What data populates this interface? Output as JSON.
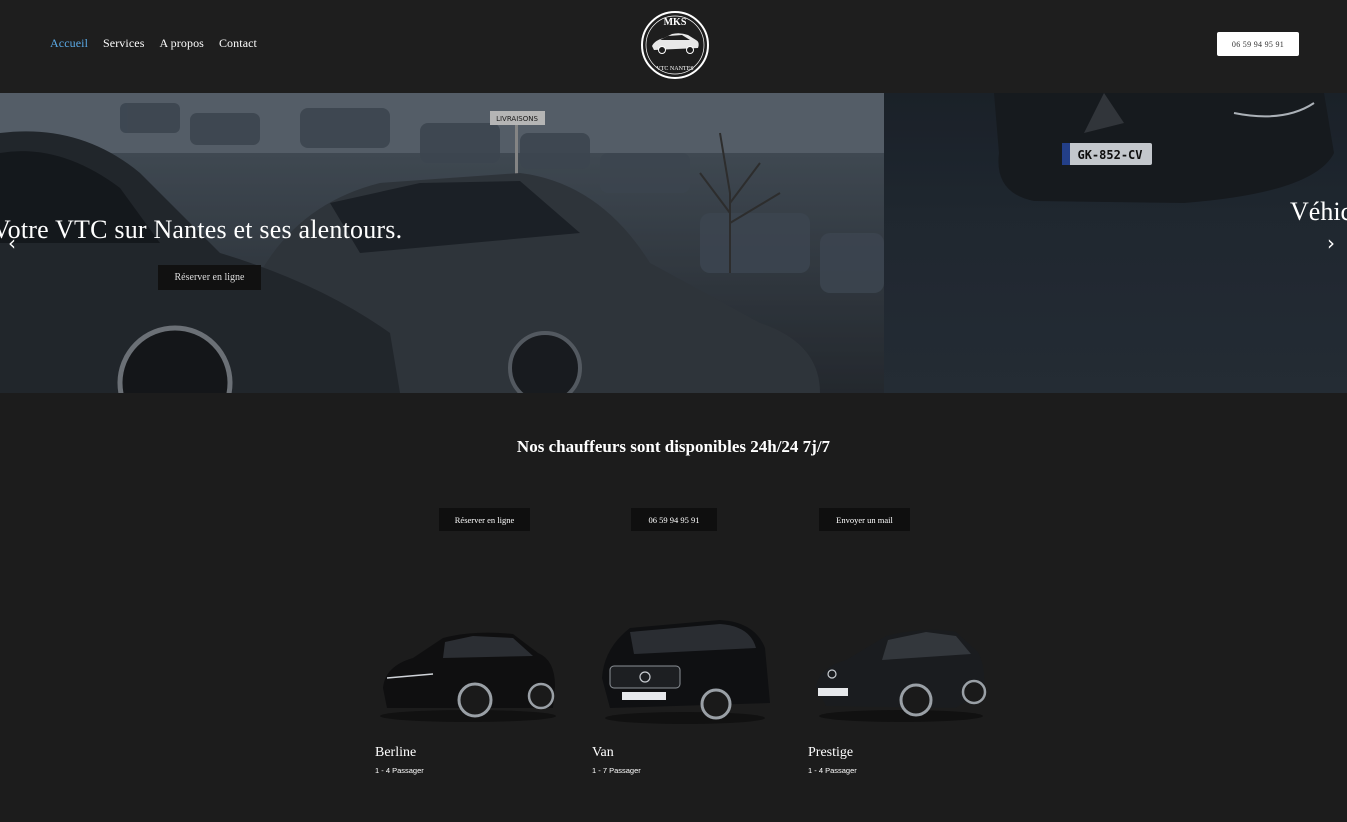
{
  "header": {
    "nav": [
      {
        "label": "Accueil",
        "active": true
      },
      {
        "label": "Services",
        "active": false
      },
      {
        "label": "A propos",
        "active": false
      },
      {
        "label": "Contact",
        "active": false
      }
    ],
    "logo": {
      "top_text": "MKS",
      "bottom_text": "VTC NANTES"
    },
    "phone": "06 59 94 95 91"
  },
  "hero": {
    "slide1": {
      "title": "Votre VTC sur Nantes et ses alentours.",
      "button": "Réserver en ligne",
      "plate": "LIVRAISONS"
    },
    "slide2": {
      "title_partial": "Véhic",
      "plate": "GK-852-CV"
    },
    "prev_icon": "chevron-left-icon",
    "next_icon": "chevron-right-icon"
  },
  "availability": {
    "title": "Nos chauffeurs sont disponibles 24h/24 7j/7",
    "buttons": [
      "Réserver en ligne",
      "06 59 94 95 91",
      "Envoyer un mail"
    ]
  },
  "vehicles": [
    {
      "name": "Berline",
      "capacity": "1 - 4 Passager"
    },
    {
      "name": "Van",
      "capacity": "1 - 7 Passager"
    },
    {
      "name": "Prestige",
      "capacity": "1 - 4 Passager"
    }
  ],
  "colors": {
    "background": "#1c1c1c",
    "active_nav": "#5aa9e6",
    "button_dark": "#0f0f0f"
  }
}
